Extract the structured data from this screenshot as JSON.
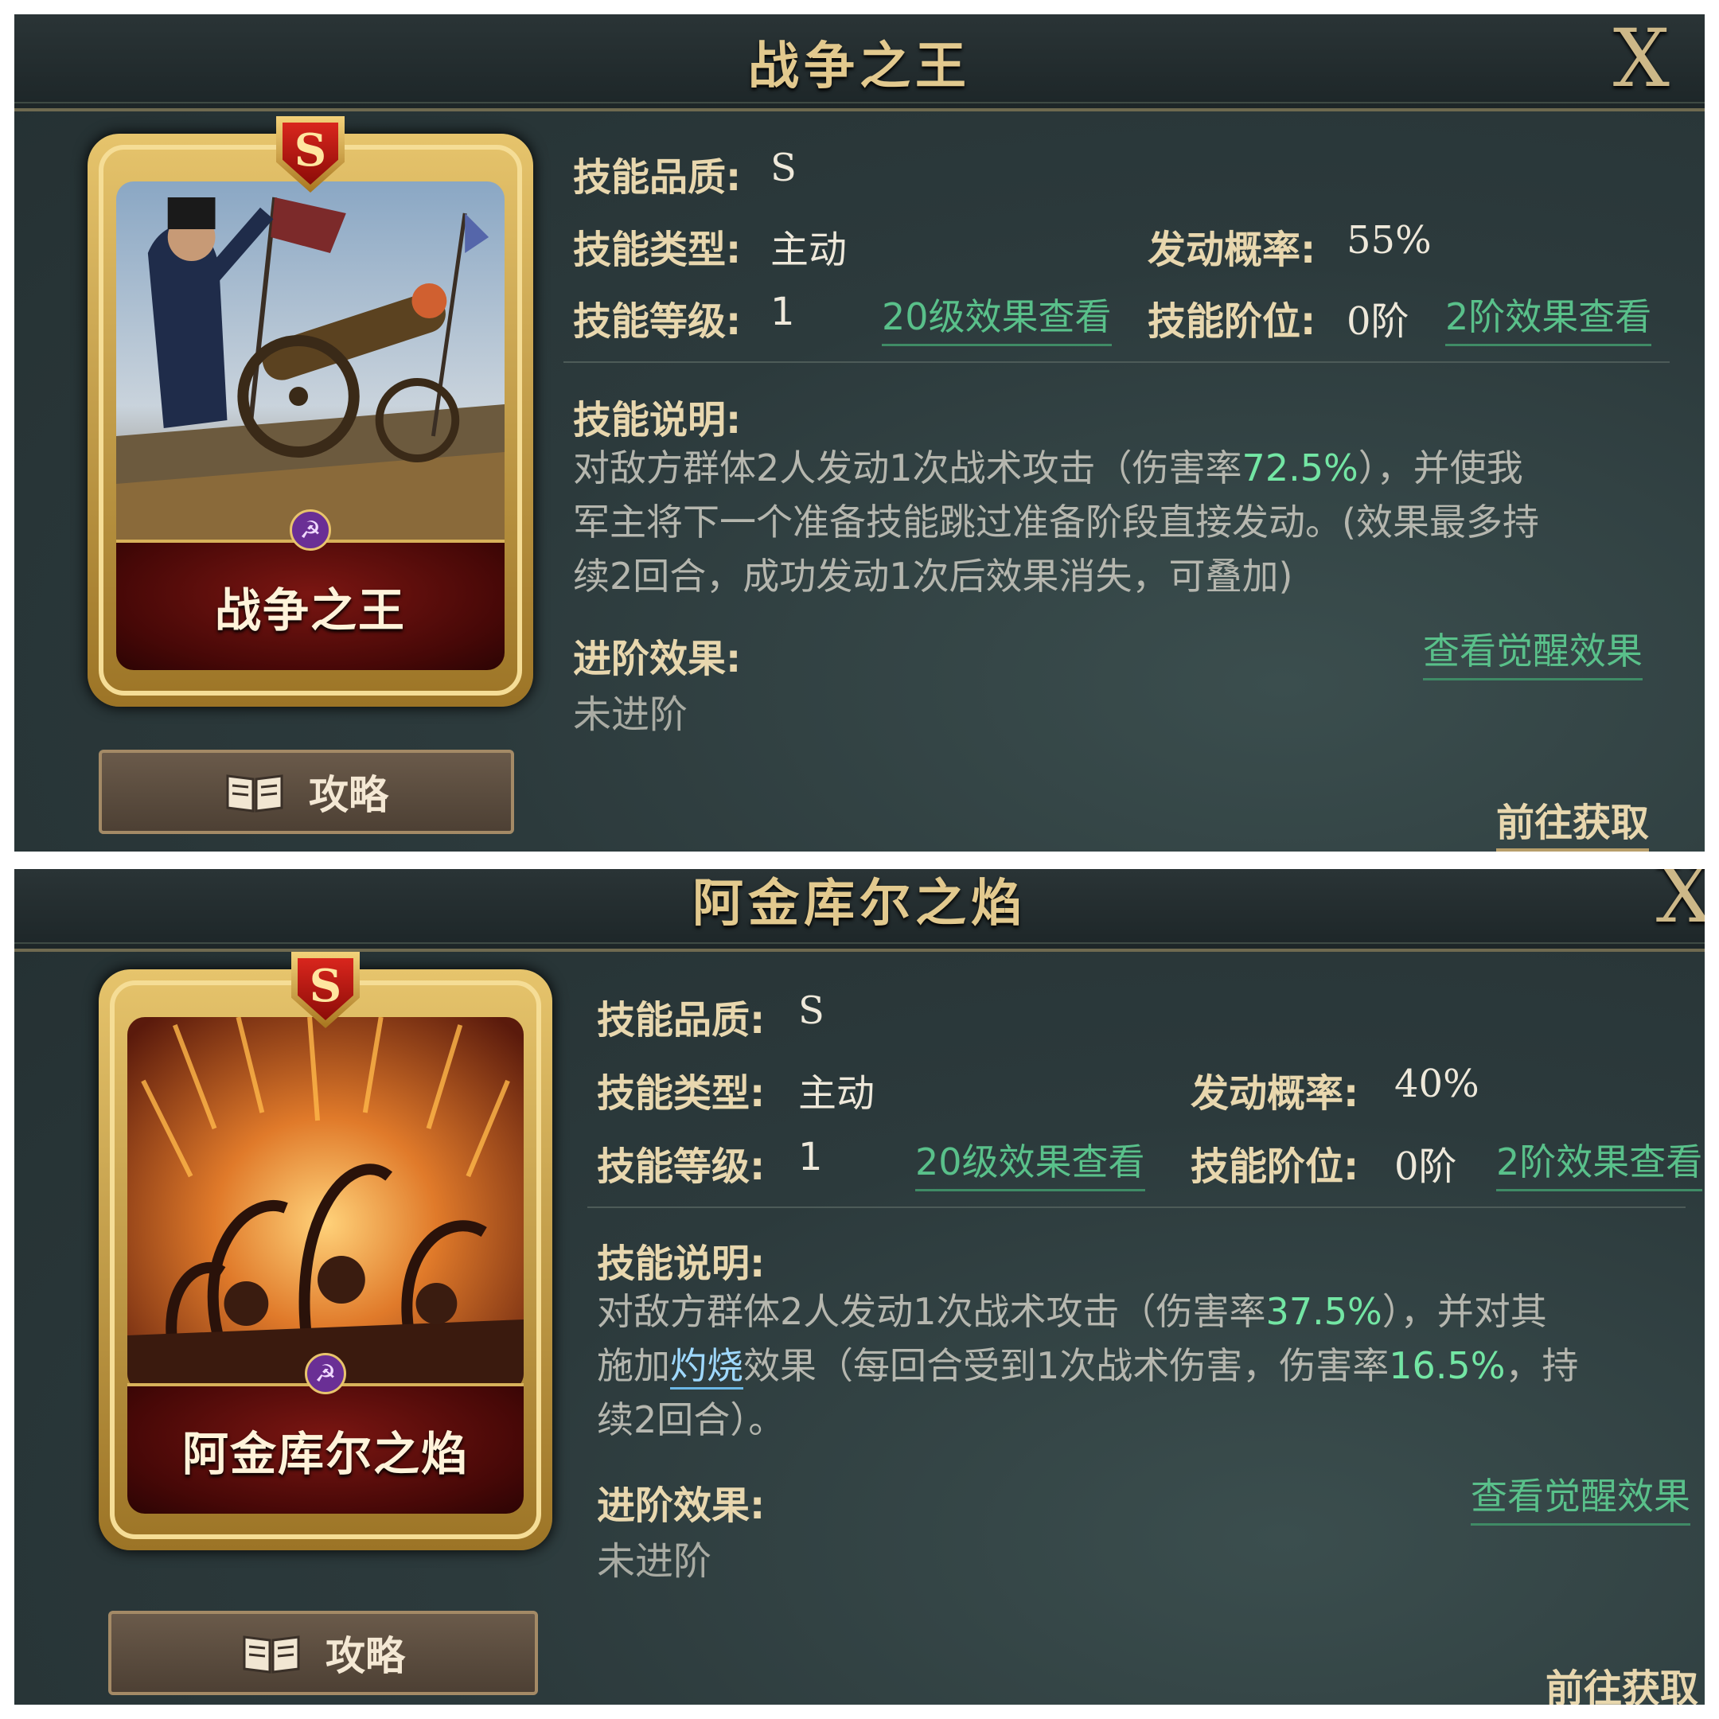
{
  "panels": [
    {
      "title": "战争之王",
      "close_label": "X",
      "card": {
        "name": "战争之王",
        "rank": "S"
      },
      "guide_label": "攻略",
      "quality": {
        "label": "技能品质:",
        "value": "S"
      },
      "type": {
        "label": "技能类型:",
        "value": "主动"
      },
      "rate": {
        "label": "发动概率:",
        "value": "55%"
      },
      "level": {
        "label": "技能等级:",
        "value": "1",
        "link": "20级效果查看"
      },
      "tier": {
        "label": "技能阶位:",
        "value": "0阶",
        "link": "2阶效果查看"
      },
      "desc_label": "技能说明:",
      "desc": {
        "l1a": "对敌方群体2人发动1次战术攻击（伤害率",
        "l1hl": "72.5%",
        "l1b": "），并使我",
        "l2": "军主将下一个准备技能跳过准备阶段直接发动。(效果最多持",
        "l3": "续2回合，成功发动1次后效果消失，可叠加)"
      },
      "advance_label": "进阶效果:",
      "awaken_link": "查看觉醒效果",
      "advance_value": "未进阶",
      "goto_label": "前往获取"
    },
    {
      "title": "阿金库尔之焰",
      "close_label": "X",
      "card": {
        "name": "阿金库尔之焰",
        "rank": "S"
      },
      "guide_label": "攻略",
      "quality": {
        "label": "技能品质:",
        "value": "S"
      },
      "type": {
        "label": "技能类型:",
        "value": "主动"
      },
      "rate": {
        "label": "发动概率:",
        "value": "40%"
      },
      "level": {
        "label": "技能等级:",
        "value": "1",
        "link": "20级效果查看"
      },
      "tier": {
        "label": "技能阶位:",
        "value": "0阶",
        "link": "2阶效果查看"
      },
      "desc_label": "技能说明:",
      "desc": {
        "l1a": "对敌方群体2人发动1次战术攻击（伤害率",
        "l1hl": "37.5%",
        "l1b": "），并对其",
        "l2a": "施加",
        "l2kw": "灼烧",
        "l2b": "效果（每回合受到1次战术伤害，伤害率",
        "l2hl": "16.5%",
        "l2c": "，持",
        "l3": "续2回合）。"
      },
      "advance_label": "进阶效果:",
      "awaken_link": "查看觉醒效果",
      "advance_value": "未进阶",
      "goto_label": "前往获取"
    }
  ],
  "icons": {
    "close": "close-x-icon",
    "guide": "book-icon",
    "faction": "faction-emblem-icon",
    "rank": "rank-shield-icon"
  },
  "colors": {
    "link_green": "#59c08a",
    "highlight_green": "#73e6a4",
    "label_gold": "#e8d7ae",
    "keyword_blue": "#9fd9ff"
  }
}
